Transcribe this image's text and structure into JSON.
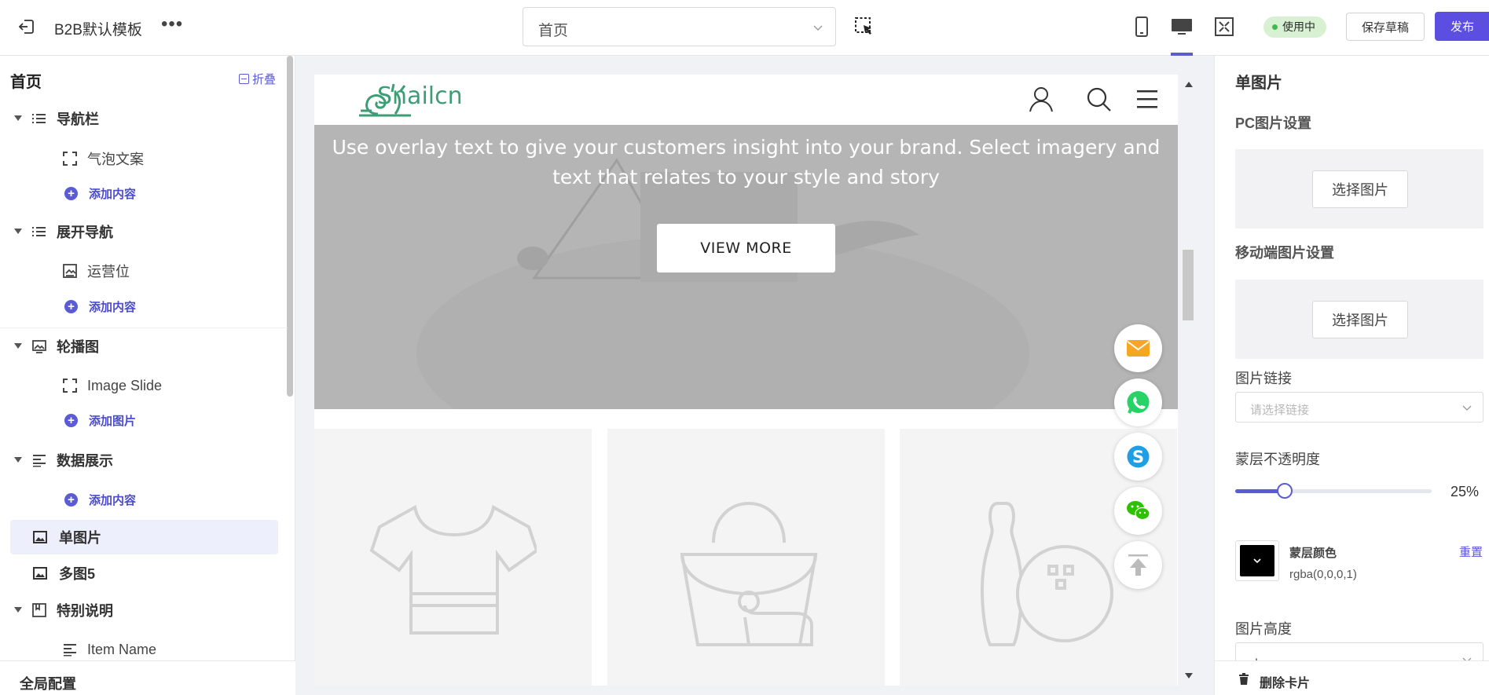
{
  "topbar": {
    "template_title": "B2B默认模板",
    "more_label": "•••",
    "page_select_value": "首页",
    "status_label": "使用中",
    "save_draft_label": "保存草稿",
    "publish_label": "发布"
  },
  "left_panel": {
    "title": "首页",
    "collapse_label": "折叠",
    "items": [
      {
        "label": "导航栏"
      },
      {
        "label": "气泡文案"
      },
      {
        "label": "添加内容"
      },
      {
        "label": "展开导航"
      },
      {
        "label": "运营位"
      },
      {
        "label": "添加内容"
      },
      {
        "label": "轮播图"
      },
      {
        "label": "Image Slide"
      },
      {
        "label": "添加图片"
      },
      {
        "label": "数据展示"
      },
      {
        "label": "添加内容"
      },
      {
        "label": "单图片"
      },
      {
        "label": "多图5"
      },
      {
        "label": "特别说明"
      },
      {
        "label": "Item Name"
      }
    ],
    "footer_label": "全局配置"
  },
  "preview": {
    "logo_text": "Snailcn",
    "hero_text": "Use overlay text to give your customers insight into your brand. Select imagery and text that relates to your style and story",
    "hero_button": "VIEW MORE"
  },
  "right_panel": {
    "title": "单图片",
    "pc_image_label": "PC图片设置",
    "pc_choose_button": "选择图片",
    "mobile_image_label": "移动端图片设置",
    "mobile_choose_button": "选择图片",
    "link_label": "图片链接",
    "link_placeholder": "请选择链接",
    "opacity_label": "蒙层不透明度",
    "opacity_value": "25%",
    "opacity_fraction": 0.25,
    "color_label": "蒙层颜色",
    "color_value": "rgba(0,0,0,1)",
    "color_reset": "重置",
    "height_label": "图片高度",
    "height_value": "中",
    "delete_label": "删除卡片"
  },
  "colors": {
    "accent": "#5b5bd6",
    "publish_bg": "#5c4ee0",
    "logo_green": "#3d9e75",
    "email_orange": "#f5a623",
    "whatsapp_green": "#25d366",
    "skype_blue": "#1e9ee5",
    "wechat_green": "#2dc100"
  }
}
